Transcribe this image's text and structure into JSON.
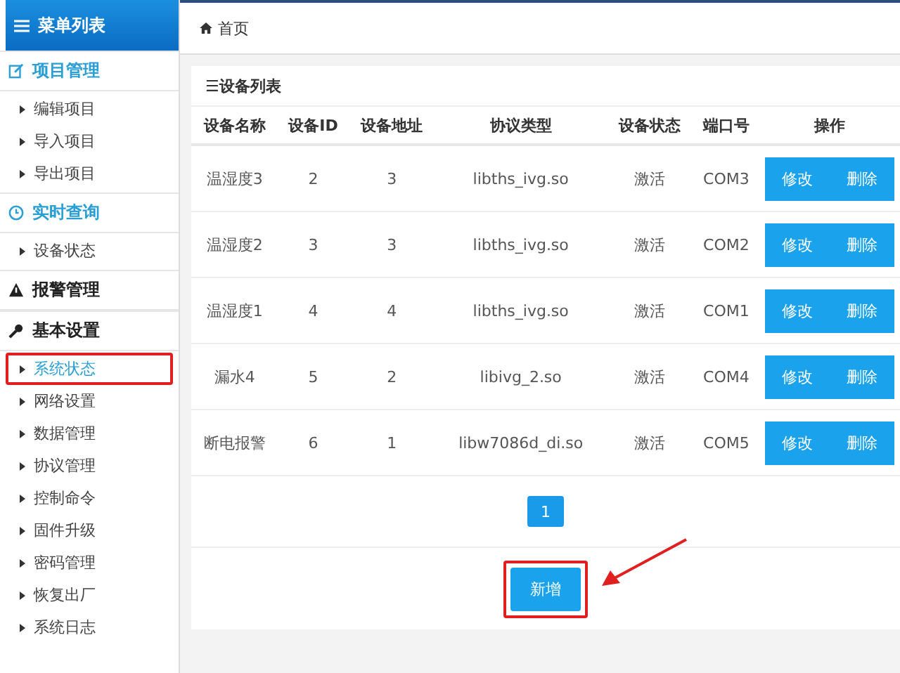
{
  "sidebar": {
    "title": "菜单列表",
    "sections": [
      {
        "label": "项目管理",
        "active": true,
        "items": [
          {
            "label": "编辑项目",
            "selected": false,
            "annotated": false
          },
          {
            "label": "导入项目",
            "selected": false,
            "annotated": false
          },
          {
            "label": "导出项目",
            "selected": false,
            "annotated": false
          }
        ]
      },
      {
        "label": "实时查询",
        "active": true,
        "items": [
          {
            "label": "设备状态",
            "selected": false,
            "annotated": false
          }
        ]
      },
      {
        "label": "报警管理",
        "active": false
      },
      {
        "label": "基本设置",
        "active": false,
        "items": [
          {
            "label": "系统状态",
            "selected": true,
            "annotated": true
          },
          {
            "label": "网络设置",
            "selected": false,
            "annotated": false
          },
          {
            "label": "数据管理",
            "selected": false,
            "annotated": false
          },
          {
            "label": "协议管理",
            "selected": false,
            "annotated": false
          },
          {
            "label": "控制命令",
            "selected": false,
            "annotated": false
          },
          {
            "label": "固件升级",
            "selected": false,
            "annotated": false
          },
          {
            "label": "密码管理",
            "selected": false,
            "annotated": false
          },
          {
            "label": "恢复出厂",
            "selected": false,
            "annotated": false
          },
          {
            "label": "系统日志",
            "selected": false,
            "annotated": false
          }
        ]
      }
    ]
  },
  "breadcrumb": "首页",
  "panel": {
    "title": "☰设备列表",
    "table": {
      "columns": [
        "设备名称",
        "设备ID",
        "设备地址",
        "协议类型",
        "设备状态",
        "端口号",
        "操作"
      ],
      "rows": [
        {
          "cells": [
            "温湿度3",
            "2",
            "3",
            "libths_ivg.so",
            "激活",
            "COM3"
          ],
          "actions": [
            "修改",
            "删除"
          ]
        },
        {
          "cells": [
            "温湿度2",
            "3",
            "3",
            "libths_ivg.so",
            "激活",
            "COM2"
          ],
          "actions": [
            "修改",
            "删除"
          ]
        },
        {
          "cells": [
            "温湿度1",
            "4",
            "4",
            "libths_ivg.so",
            "激活",
            "COM1"
          ],
          "actions": [
            "修改",
            "删除"
          ]
        },
        {
          "cells": [
            "漏水4",
            "5",
            "2",
            "libivg_2.so",
            "激活",
            "COM4"
          ],
          "actions": [
            "修改",
            "删除"
          ]
        },
        {
          "cells": [
            "断电报警",
            "6",
            "1",
            "libw7086d_di.so",
            "激活",
            "COM5"
          ],
          "actions": [
            "修改",
            "删除"
          ]
        }
      ]
    },
    "pages": [
      {
        "label": "1",
        "selected": true
      }
    ],
    "add_button": {
      "label": "新增",
      "annotated": true
    }
  }
}
